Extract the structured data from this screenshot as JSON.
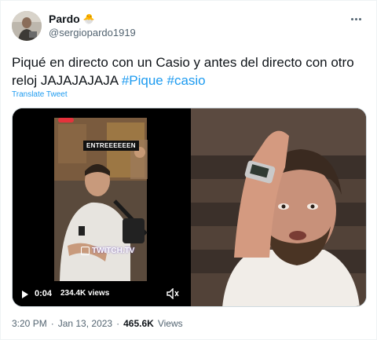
{
  "user": {
    "display_name": "Pardo",
    "emoji": "🐣",
    "handle": "@sergiopardo1919"
  },
  "tweet": {
    "text_prefix": "Piqué en directo con un Casio y antes del directo con otro reloj JAJAJAJAJA ",
    "hashtags": [
      "#Pique",
      "#casio"
    ],
    "translate_label": "Translate Tweet",
    "time": "3:20 PM",
    "date": "Jan 13, 2023",
    "separator": "·",
    "views_count": "465.6K",
    "views_label": "Views"
  },
  "media": {
    "video_overlay_text": "ENTREEEEEEN",
    "twitch_label": "TWITCH.TV",
    "play_time": "0:04",
    "video_views": "234.4K views"
  },
  "icons": {
    "more": "more-dots-icon",
    "play": "play-icon",
    "mute": "speaker-icon",
    "chick": "chick-emoji-icon"
  },
  "colors": {
    "accent": "#1d9bf0",
    "text": "#0f1419",
    "secondary": "#536471"
  }
}
